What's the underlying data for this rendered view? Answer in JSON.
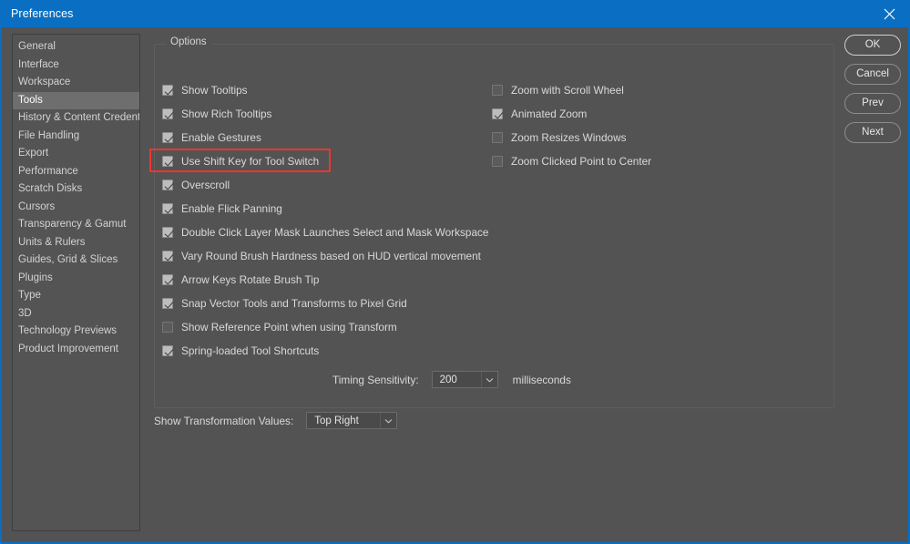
{
  "window": {
    "title": "Preferences",
    "close_icon": "close-icon",
    "accent_color": "#0a6fc2",
    "background_color": "#535353",
    "highlight_color": "#f0352f"
  },
  "sidebar": {
    "selected": "Tools",
    "items": [
      {
        "label": "General"
      },
      {
        "label": "Interface"
      },
      {
        "label": "Workspace"
      },
      {
        "label": "Tools"
      },
      {
        "label": "History & Content Credentials"
      },
      {
        "label": "File Handling"
      },
      {
        "label": "Export"
      },
      {
        "label": "Performance"
      },
      {
        "label": "Scratch Disks"
      },
      {
        "label": "Cursors"
      },
      {
        "label": "Transparency & Gamut"
      },
      {
        "label": "Units & Rulers"
      },
      {
        "label": "Guides, Grid & Slices"
      },
      {
        "label": "Plugins"
      },
      {
        "label": "Type"
      },
      {
        "label": "3D"
      },
      {
        "label": "Technology Previews"
      },
      {
        "label": "Product Improvement"
      }
    ]
  },
  "options": {
    "legend": "Options",
    "left_column": [
      {
        "label": "Show Tooltips",
        "checked": true
      },
      {
        "label": "Show Rich Tooltips",
        "checked": true
      },
      {
        "label": "Enable Gestures",
        "checked": true
      },
      {
        "label": "Use Shift Key for Tool Switch",
        "checked": true,
        "highlighted": true
      },
      {
        "label": "Overscroll",
        "checked": true
      },
      {
        "label": "Enable Flick Panning",
        "checked": true
      },
      {
        "label": "Double Click Layer Mask Launches Select and Mask Workspace",
        "checked": true
      },
      {
        "label": "Vary Round Brush Hardness based on HUD vertical movement",
        "checked": true
      },
      {
        "label": "Arrow Keys Rotate Brush Tip",
        "checked": true
      },
      {
        "label": "Snap Vector Tools and Transforms to Pixel Grid",
        "checked": true
      },
      {
        "label": "Show Reference Point when using Transform",
        "checked": false
      },
      {
        "label": "Spring-loaded Tool Shortcuts",
        "checked": true
      }
    ],
    "right_column": [
      {
        "label": "Zoom with Scroll Wheel",
        "checked": false
      },
      {
        "label": "Animated Zoom",
        "checked": true
      },
      {
        "label": "Zoom Resizes Windows",
        "checked": false
      },
      {
        "label": "Zoom Clicked Point to Center",
        "checked": false
      }
    ],
    "timing": {
      "label": "Timing Sensitivity:",
      "value": "200",
      "unit": "milliseconds",
      "chevron_icon": "chevron-down-icon"
    },
    "transformation": {
      "label": "Show Transformation Values:",
      "value": "Top Right",
      "chevron_icon": "chevron-down-icon"
    }
  },
  "buttons": [
    {
      "label": "OK",
      "primary": true
    },
    {
      "label": "Cancel",
      "primary": false
    },
    {
      "label": "Prev",
      "primary": false
    },
    {
      "label": "Next",
      "primary": false
    }
  ]
}
